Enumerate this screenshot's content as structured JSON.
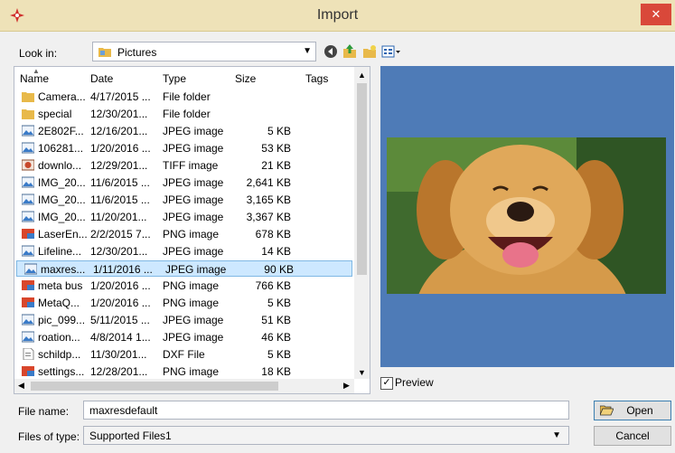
{
  "window": {
    "title": "Import",
    "close_glyph": "✕"
  },
  "toolbar": {
    "lookin_label": "Look in:",
    "lookin_value": "Pictures",
    "icons": [
      "back-icon",
      "up-folder-icon",
      "new-folder-icon",
      "view-menu-icon"
    ]
  },
  "columns": {
    "name": "Name",
    "date": "Date",
    "type": "Type",
    "size": "Size",
    "tags": "Tags"
  },
  "files": [
    {
      "icon": "folder",
      "name": "Camera...",
      "date": "4/17/2015 ...",
      "type": "File folder",
      "size": ""
    },
    {
      "icon": "folder",
      "name": "special",
      "date": "12/30/201...",
      "type": "File folder",
      "size": ""
    },
    {
      "icon": "image",
      "name": "2E802F...",
      "date": "12/16/201...",
      "type": "JPEG image",
      "size": "5 KB"
    },
    {
      "icon": "image",
      "name": "106281...",
      "date": "1/20/2016 ...",
      "type": "JPEG image",
      "size": "53 KB"
    },
    {
      "icon": "tiff",
      "name": "downlo...",
      "date": "12/29/201...",
      "type": "TIFF image",
      "size": "21 KB"
    },
    {
      "icon": "image",
      "name": "IMG_20...",
      "date": "11/6/2015 ...",
      "type": "JPEG image",
      "size": "2,641 KB"
    },
    {
      "icon": "image",
      "name": "IMG_20...",
      "date": "11/6/2015 ...",
      "type": "JPEG image",
      "size": "3,165 KB"
    },
    {
      "icon": "image",
      "name": "IMG_20...",
      "date": "11/20/201...",
      "type": "JPEG image",
      "size": "3,367 KB"
    },
    {
      "icon": "png",
      "name": "LaserEn...",
      "date": "2/2/2015 7...",
      "type": "PNG image",
      "size": "678 KB"
    },
    {
      "icon": "image",
      "name": "Lifeline...",
      "date": "12/30/201...",
      "type": "JPEG image",
      "size": "14 KB"
    },
    {
      "icon": "image",
      "name": "maxres...",
      "date": "1/11/2016 ...",
      "type": "JPEG image",
      "size": "90 KB",
      "selected": true
    },
    {
      "icon": "png",
      "name": "meta bus",
      "date": "1/20/2016 ...",
      "type": "PNG image",
      "size": "766 KB"
    },
    {
      "icon": "png",
      "name": "MetaQ...",
      "date": "1/20/2016 ...",
      "type": "PNG image",
      "size": "5 KB"
    },
    {
      "icon": "image",
      "name": "pic_099...",
      "date": "5/11/2015 ...",
      "type": "JPEG image",
      "size": "51 KB"
    },
    {
      "icon": "image",
      "name": "roation...",
      "date": "4/8/2014 1...",
      "type": "JPEG image",
      "size": "46 KB"
    },
    {
      "icon": "doc",
      "name": "schildp...",
      "date": "11/30/201...",
      "type": "DXF File",
      "size": "5 KB"
    },
    {
      "icon": "png",
      "name": "settings...",
      "date": "12/28/201...",
      "type": "PNG image",
      "size": "18 KB"
    }
  ],
  "preview": {
    "label": "Preview",
    "checked": true
  },
  "bottom": {
    "filename_label": "File name:",
    "filename_value": "maxresdefault",
    "filetype_label": "Files of type:",
    "filetype_value": "Supported Files1",
    "open_label": "Open",
    "cancel_label": "Cancel"
  },
  "colors": {
    "accent": "#3c7fb1",
    "preview_bg": "#4e7bb7",
    "selection": "#cde8ff",
    "title_bar": "#eee2b8"
  }
}
